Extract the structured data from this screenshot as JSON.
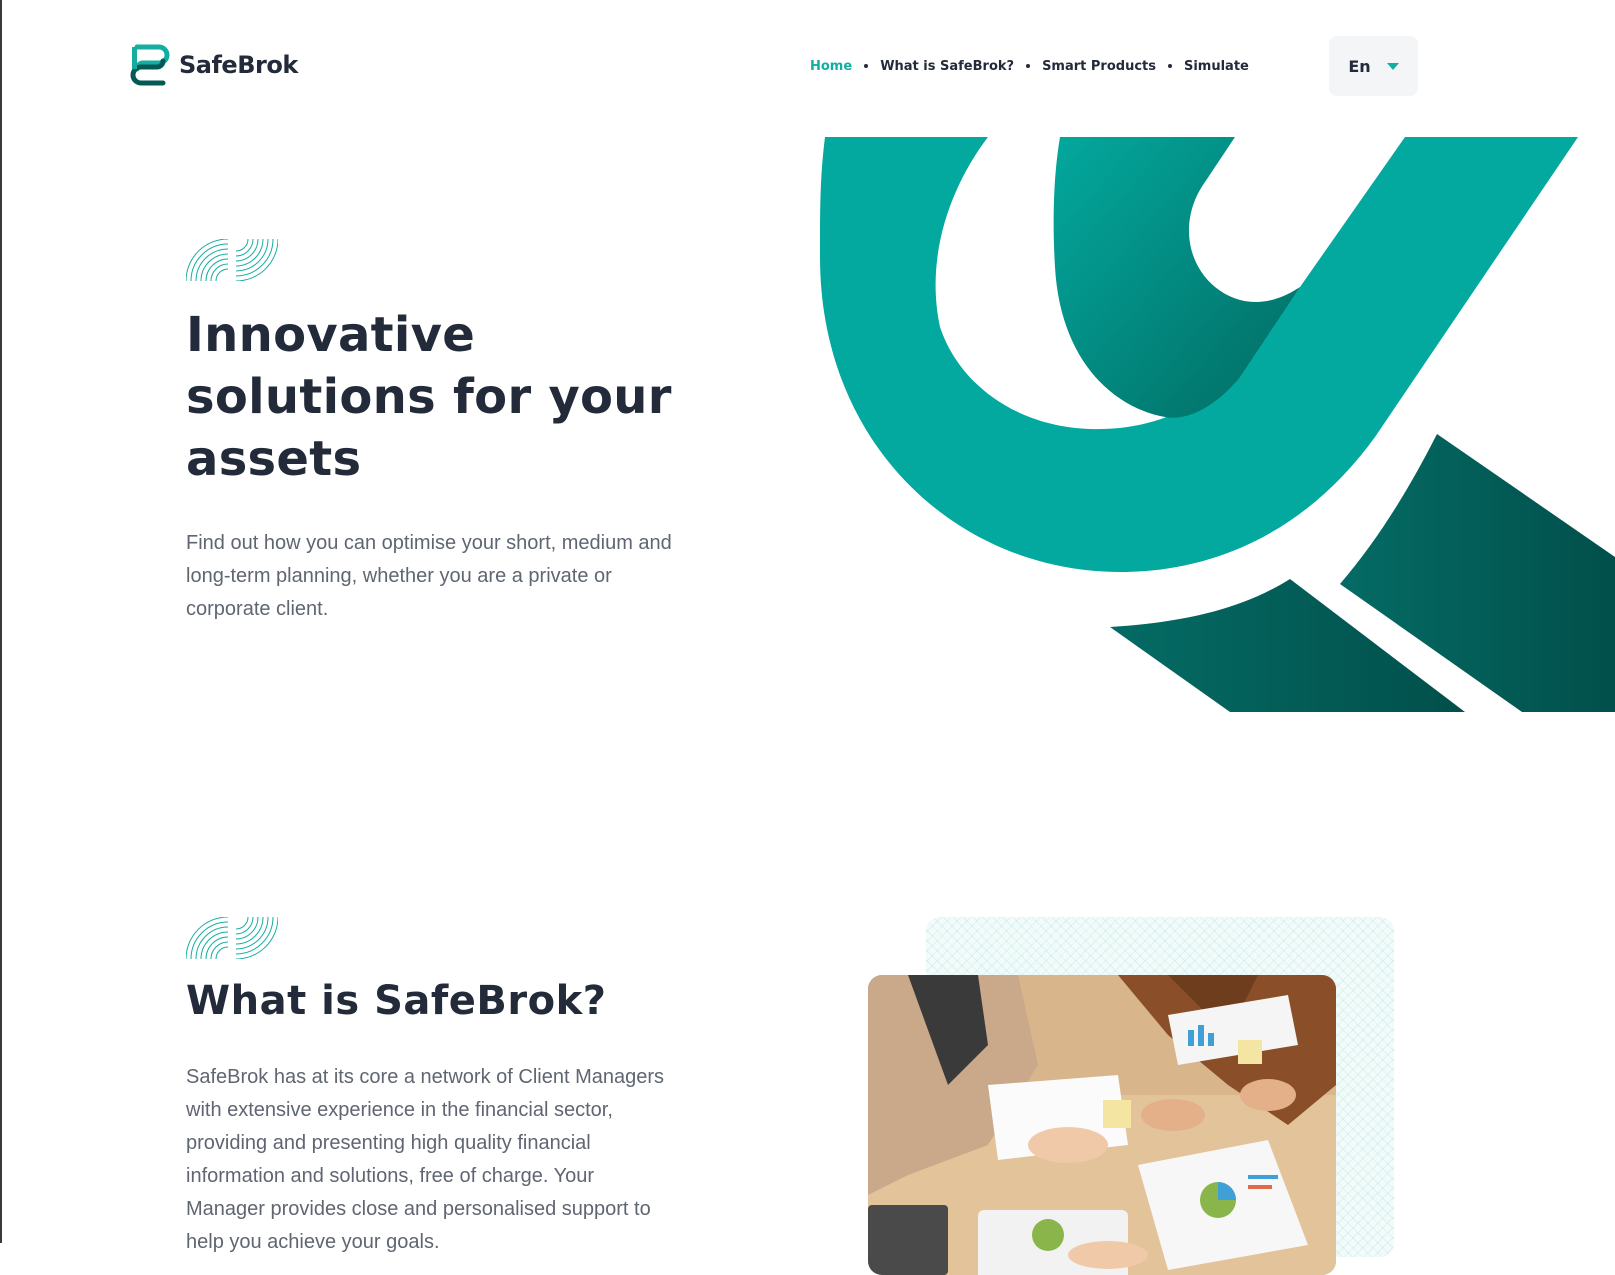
{
  "brand": {
    "name": "SafeBrok",
    "logo_icon": "safebrok-logo-icon"
  },
  "nav": {
    "items": [
      {
        "label": "Home",
        "active": true
      },
      {
        "label": "What is SafeBrok?",
        "active": false
      },
      {
        "label": "Smart Products",
        "active": false
      },
      {
        "label": "Simulate",
        "active": false
      }
    ]
  },
  "language": {
    "selected": "En",
    "icon": "caret-down-icon"
  },
  "hero": {
    "title": "Innovative solutions for your assets",
    "text": "Find out how you can optimise your short, medium and long-term planning, whether you are a private or corporate client."
  },
  "about": {
    "title": "What is SafeBrok?",
    "text": "SafeBrok has at its core a network of Client Managers with extensive experience in the financial sector, providing and presenting high quality financial information and solutions, free of charge. Your Manager provides close and personalised support to help you achieve your goals."
  },
  "colors": {
    "accent": "#14aea1",
    "teal": "#03a89e",
    "dark_teal": "#035a55",
    "text_dark": "#232b3a",
    "text_muted": "#5f6672"
  }
}
